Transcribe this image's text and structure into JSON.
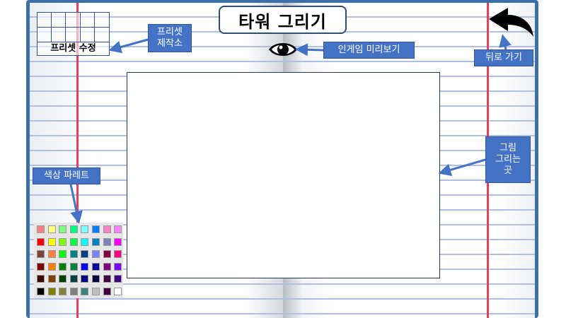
{
  "title": "타워 그리기",
  "preset": {
    "label": "프리셋 수정"
  },
  "callouts": {
    "preset_workshop": [
      "프리셋",
      "제작소"
    ],
    "ingame_preview": "인게임 미리보기",
    "go_back": "뒤로 가기",
    "drawing_area": [
      "그림",
      "그리는",
      "곳"
    ],
    "color_palette": "색상 파레트"
  },
  "icons": {
    "preview": "eye-icon",
    "back": "back-arrow-icon"
  },
  "colors": {
    "accent": "#4472c4",
    "margin_line": "#e8405c",
    "ruled_line": "#aebfe6",
    "book_cover": "#3d6fa8"
  },
  "palette": [
    [
      "#ff8080",
      "#ffff80",
      "#80ff80",
      "#00ff80",
      "#80ffff",
      "#0080ff",
      "#ff80c0",
      "#ff80ff"
    ],
    [
      "#ff0000",
      "#ffff00",
      "#80ff00",
      "#00ff40",
      "#00ffff",
      "#0080c0",
      "#8080c0",
      "#ff00ff"
    ],
    [
      "#804040",
      "#ff8040",
      "#00ff00",
      "#008080",
      "#004080",
      "#8080ff",
      "#800040",
      "#ff0080"
    ],
    [
      "#800000",
      "#ff8000",
      "#008000",
      "#008040",
      "#0000ff",
      "#0000a0",
      "#800080",
      "#8000ff"
    ],
    [
      "#400000",
      "#804000",
      "#004000",
      "#004040",
      "#000080",
      "#000040",
      "#400040",
      "#400080"
    ],
    [
      "#000000",
      "#808000",
      "#808040",
      "#808080",
      "#408080",
      "#c0c0c0",
      "#400040",
      "#ffffff"
    ]
  ]
}
